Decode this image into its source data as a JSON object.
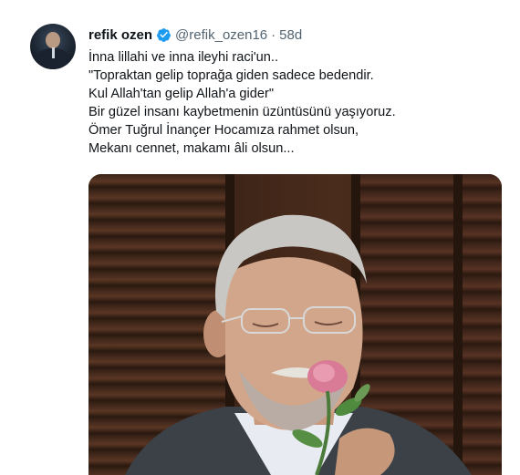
{
  "tweet": {
    "author_name": "refik ozen",
    "handle": "@refik_ozen16",
    "separator": "·",
    "time": "58d",
    "verified_icon": "verified-badge-icon",
    "lines": [
      "İnna lillahi ve inna ileyhi raci'un..",
      "\"Topraktan gelip toprağa giden sadece bedendir.",
      "Kul Allah'tan gelip Allah'a gider\"",
      "Bir güzel insanı kaybetmenin üzüntüsünü yaşıyoruz.",
      "Ömer Tuğrul İnançer Hocamıza rahmet olsun,",
      "Mekanı cennet, makamı âli olsun..."
    ]
  },
  "colors": {
    "verified": "#1d9bf0",
    "secondary_text": "#536471",
    "primary_text": "#0f1419"
  }
}
